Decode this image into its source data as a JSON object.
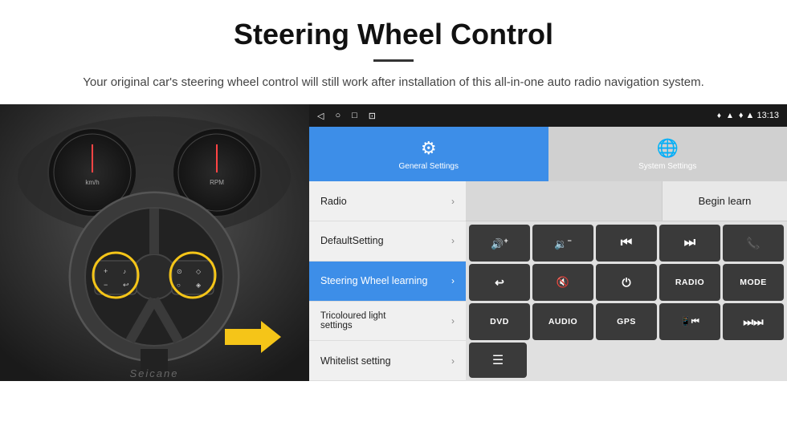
{
  "header": {
    "title": "Steering Wheel Control",
    "divider": true,
    "subtitle": "Your original car's steering wheel control will still work after installation of this all-in-one auto radio navigation system."
  },
  "statusBar": {
    "icons": [
      "◁",
      "○",
      "□",
      "⊡"
    ],
    "rightIcons": "♦ ▲ 13:13"
  },
  "tabs": [
    {
      "id": "general",
      "label": "General Settings",
      "active": true
    },
    {
      "id": "system",
      "label": "System Settings",
      "active": false
    }
  ],
  "menu": {
    "items": [
      {
        "id": "radio",
        "label": "Radio",
        "active": false
      },
      {
        "id": "default",
        "label": "DefaultSetting",
        "active": false
      },
      {
        "id": "steering",
        "label": "Steering Wheel learning",
        "active": true
      },
      {
        "id": "tricoloured",
        "label": "Tricoloured light settings",
        "active": false
      },
      {
        "id": "whitelist",
        "label": "Whitelist setting",
        "active": false
      }
    ]
  },
  "rightPanel": {
    "beginLearnLabel": "Begin learn",
    "buttons": {
      "row1": [
        {
          "id": "vol-up",
          "icon": "🔊+",
          "type": "icon"
        },
        {
          "id": "vol-down",
          "icon": "🔉−",
          "type": "icon"
        },
        {
          "id": "prev-track",
          "icon": "⏮",
          "type": "icon"
        },
        {
          "id": "next-track",
          "icon": "⏭",
          "type": "icon"
        },
        {
          "id": "phone",
          "icon": "📞",
          "type": "icon"
        }
      ],
      "row2": [
        {
          "id": "back",
          "icon": "↩",
          "type": "icon"
        },
        {
          "id": "mute",
          "icon": "🔇",
          "type": "icon"
        },
        {
          "id": "power",
          "icon": "⏻",
          "type": "icon"
        },
        {
          "id": "radio-btn",
          "label": "RADIO",
          "type": "text"
        },
        {
          "id": "mode-btn",
          "label": "MODE",
          "type": "text"
        }
      ],
      "row3": [
        {
          "id": "dvd-btn",
          "label": "DVD",
          "type": "text"
        },
        {
          "id": "audio-btn",
          "label": "AUDIO",
          "type": "text"
        },
        {
          "id": "gps-btn",
          "label": "GPS",
          "type": "text"
        },
        {
          "id": "phone2",
          "icon": "📱⏮",
          "type": "icon"
        },
        {
          "id": "skip-btn",
          "icon": "⏭⏭",
          "type": "icon"
        }
      ],
      "row4": [
        {
          "id": "list-btn",
          "icon": "≡",
          "type": "icon"
        }
      ]
    }
  },
  "watermark": "Seicane",
  "colors": {
    "activeTab": "#3d8ee8",
    "activeMenu": "#3d8ee8",
    "ctrlBtn": "#3a3a3a",
    "statusBar": "#1a1a1a"
  }
}
